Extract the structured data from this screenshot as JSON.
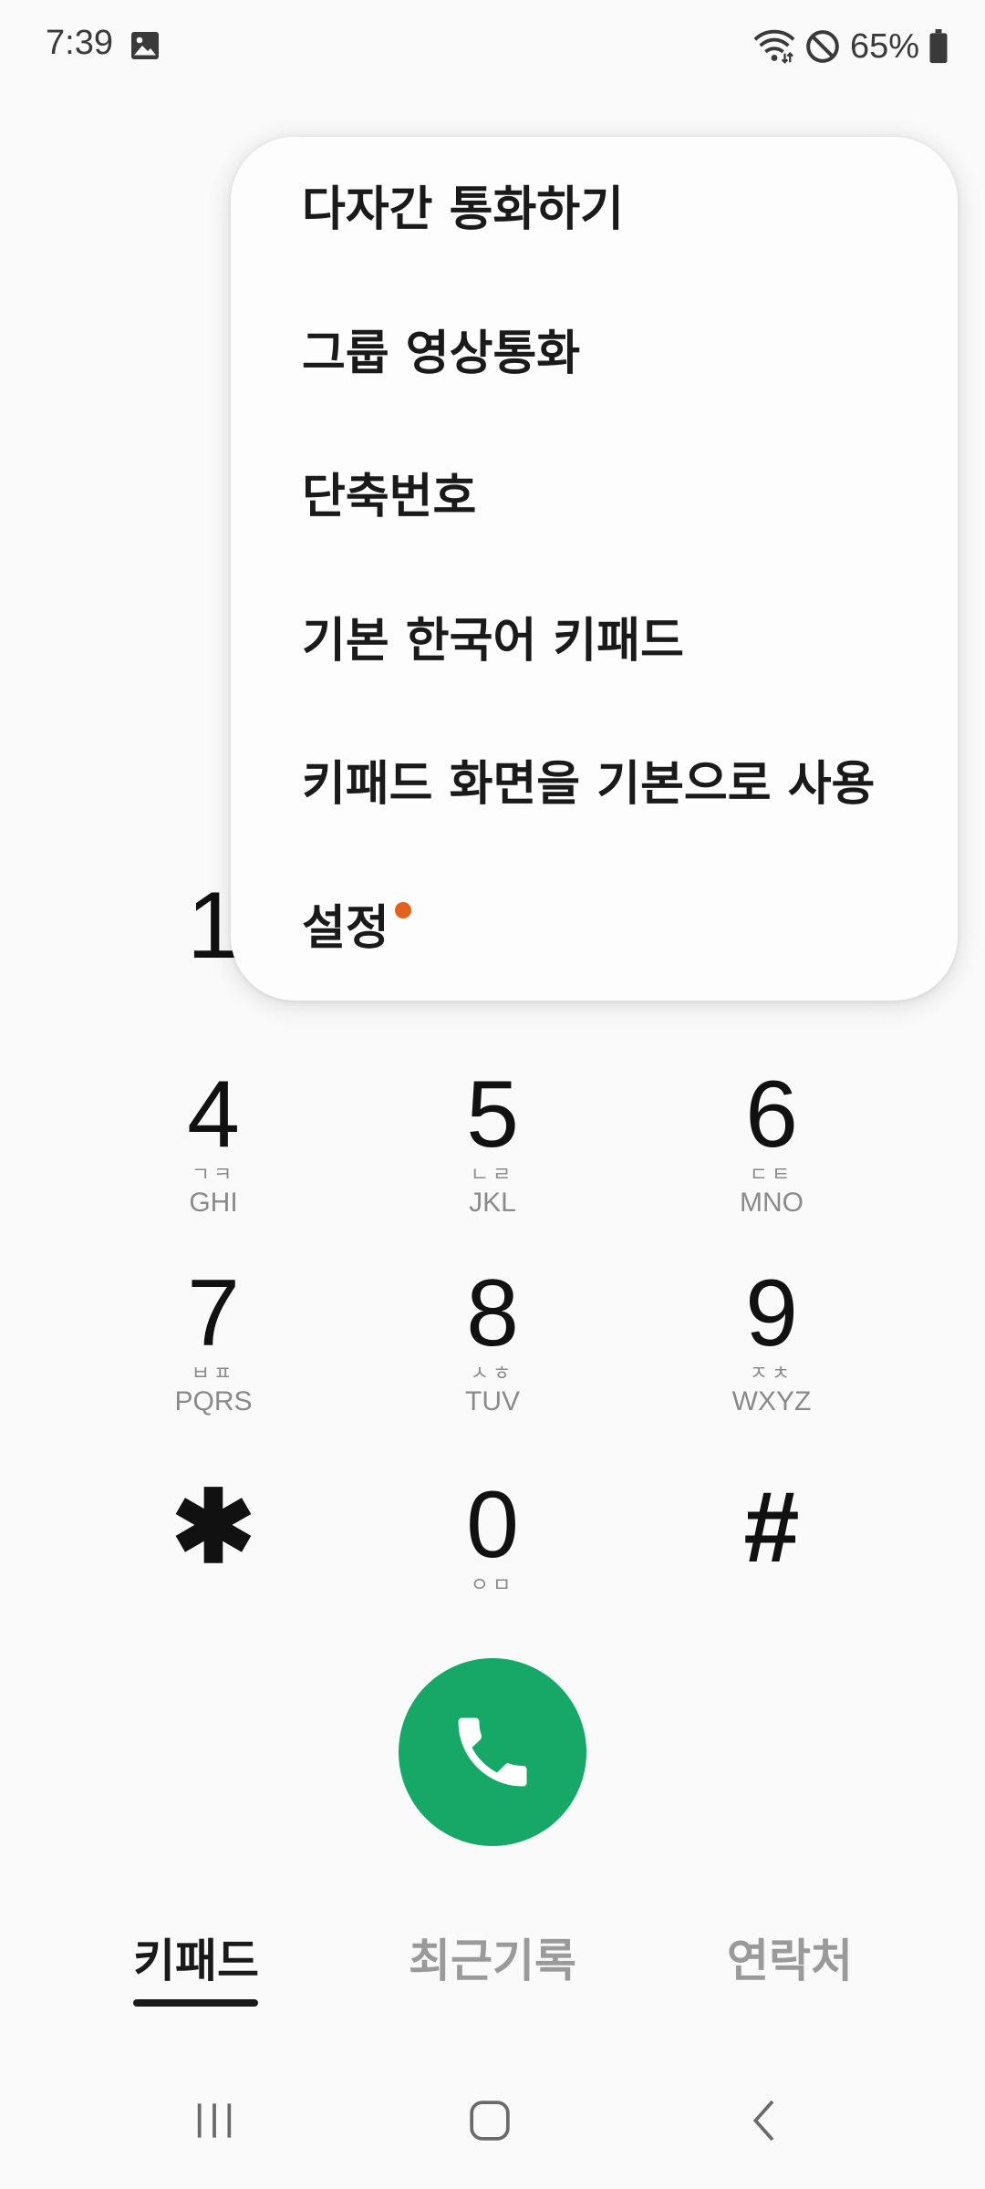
{
  "status_bar": {
    "time": "7:39",
    "battery_percent": "65%",
    "icons": [
      "gallery-icon",
      "wifi-icon",
      "do-not-disturb-icon",
      "battery-icon"
    ]
  },
  "dial_menu": {
    "items": [
      {
        "label": "다자간 통화하기"
      },
      {
        "label": "그룹 영상통화"
      },
      {
        "label": "단축번호"
      },
      {
        "label": "기본 한국어 키패드"
      },
      {
        "label": "키패드 화면을 기본으로 사용"
      },
      {
        "label": "설정",
        "has_badge": true
      }
    ],
    "badge_color": "#e2611d"
  },
  "keypad": {
    "partial_key_digit": "1",
    "keys": [
      {
        "digit": "4",
        "hangul": "ㄱㅋ",
        "latin": "GHI"
      },
      {
        "digit": "5",
        "hangul": "ㄴㄹ",
        "latin": "JKL"
      },
      {
        "digit": "6",
        "hangul": "ㄷㅌ",
        "latin": "MNO"
      },
      {
        "digit": "7",
        "hangul": "ㅂㅍ",
        "latin": "PQRS"
      },
      {
        "digit": "8",
        "hangul": "ㅅㅎ",
        "latin": "TUV"
      },
      {
        "digit": "9",
        "hangul": "ㅈㅊ",
        "latin": "WXYZ"
      },
      {
        "digit": "✱",
        "hangul": "",
        "latin": ""
      },
      {
        "digit": "0",
        "hangul": "ㅇㅁ",
        "latin": ""
      },
      {
        "digit": "#",
        "hangul": "",
        "latin": ""
      }
    ]
  },
  "call_button": {
    "icon": "phone-icon",
    "color": "#16a866"
  },
  "tabs": [
    {
      "label": "키패드",
      "active": true
    },
    {
      "label": "최근기록",
      "active": false
    },
    {
      "label": "연락처",
      "active": false
    }
  ],
  "nav_bar": {
    "icons": [
      "recents-icon",
      "home-icon",
      "back-icon"
    ]
  }
}
